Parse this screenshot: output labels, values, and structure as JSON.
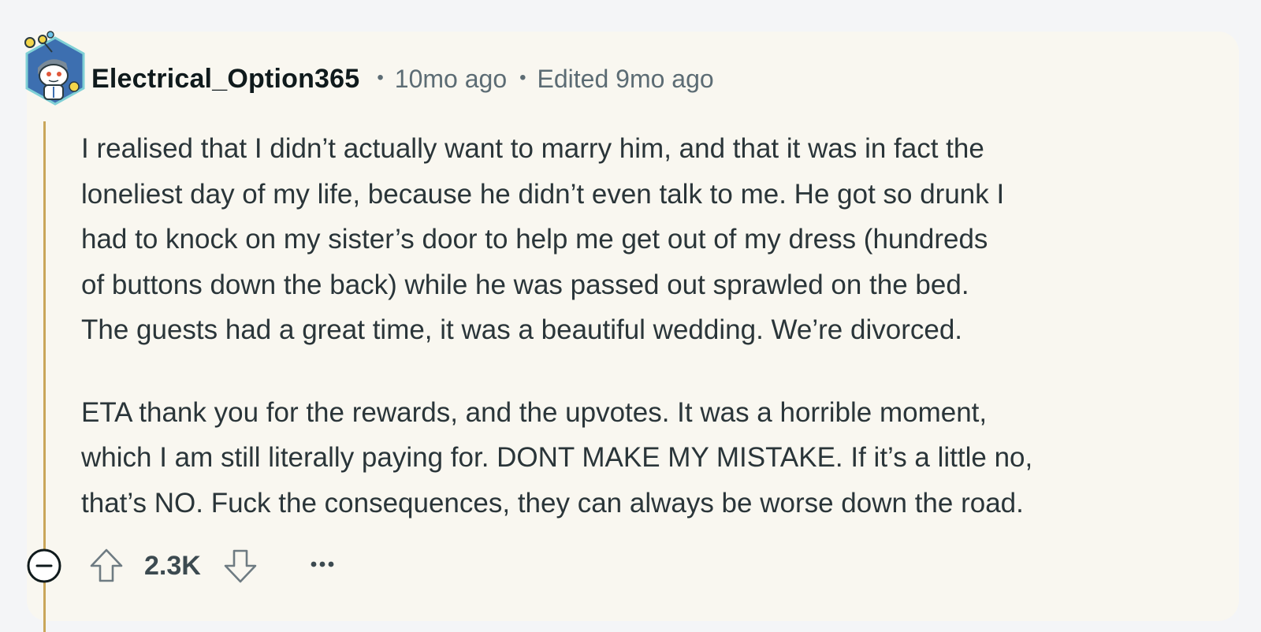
{
  "comment": {
    "username": "Electrical_Option365",
    "time_ago": "10mo ago",
    "edited": "Edited 9mo ago",
    "separator": "•",
    "paragraphs": [
      [
        "I realised that I didn’t actually want to marry him, and that it was in fact the",
        "loneliest day of my life, because he didn’t even talk to me. He got so drunk I",
        "had to knock on my sister’s door to help me get out of my dress (hundreds",
        "of buttons down the back) while he was passed out sprawled on the bed.",
        "The guests had a great time, it was a beautiful wedding. We’re divorced."
      ],
      [
        "ETA thank you for the rewards, and the upvotes. It was a horrible moment,",
        "which I am still literally paying for. DONT MAKE MY MISTAKE. If it’s a little no,",
        "that’s NO. Fuck the consequences, they can always be worse down the road."
      ]
    ],
    "vote_count": "2.3K"
  },
  "icons": {
    "avatar": "snoo-avatar-icon",
    "collapse": "collapse-minus-icon",
    "upvote": "upvote-arrow-icon",
    "downvote": "downvote-arrow-icon",
    "more": "more-options-icon"
  },
  "colors": {
    "page_background": "#f4f5f7",
    "card_background": "#f9f7f0",
    "thread_line": "#c9a65a",
    "username": "#0f1a1c",
    "meta": "#5c6c74",
    "body_text": "#2a3539"
  }
}
